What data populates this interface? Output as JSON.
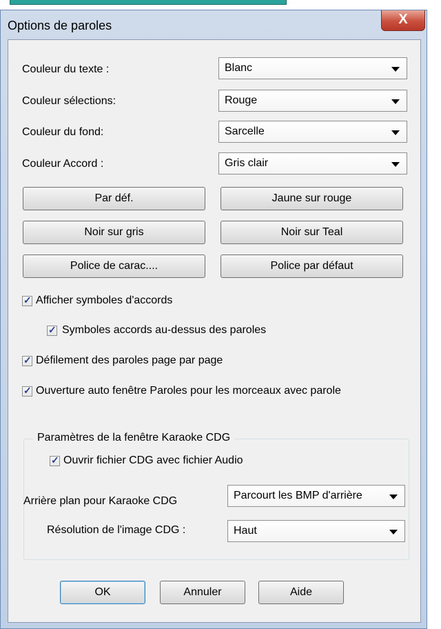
{
  "window": {
    "title": "Options de paroles",
    "close_glyph": "X"
  },
  "colors": {
    "text_color": {
      "label": "Couleur du texte :",
      "value": "Blanc"
    },
    "selection_color": {
      "label": "Couleur sélections:",
      "value": "Rouge"
    },
    "background_color": {
      "label": "Couleur du fond:",
      "value": "Sarcelle"
    },
    "chord_color": {
      "label": "Couleur Accord :",
      "value": "Gris clair"
    }
  },
  "presets": {
    "default": "Par déf.",
    "yellow_on_red": "Jaune sur rouge",
    "black_on_gray": "Noir sur gris",
    "black_on_teal": "Noir sur Teal",
    "font": "Police de carac....",
    "default_font": "Police par défaut"
  },
  "options": {
    "show_chords": {
      "label": "Afficher symboles d'accords",
      "checked": true
    },
    "chords_above": {
      "label": "Symboles accords au-dessus des paroles",
      "checked": true
    },
    "page_scroll": {
      "label": "Défilement des paroles page par page",
      "checked": true
    },
    "auto_open": {
      "label": "Ouverture auto fenêtre Paroles pour les morceaux avec parole",
      "checked": true
    }
  },
  "cdg": {
    "group_title": "Paramètres de la fenêtre Karaoke CDG",
    "open_with_audio": {
      "label": "Ouvrir fichier CDG avec fichier Audio",
      "checked": true
    },
    "background": {
      "label": "Arrière plan pour Karaoke CDG",
      "value": "Parcourt les BMP d'arrière"
    },
    "resolution": {
      "label": "Résolution de l'image CDG :",
      "value": "Haut"
    }
  },
  "actions": {
    "ok": "OK",
    "cancel": "Annuler",
    "help": "Aide"
  },
  "check_glyph": "✓"
}
